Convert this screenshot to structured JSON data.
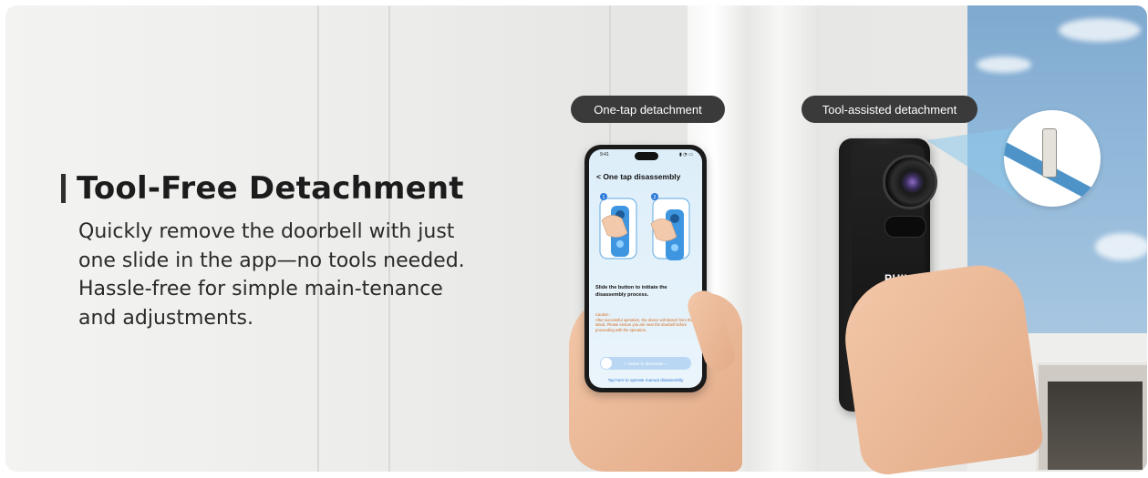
{
  "headline": "Tool-Free Detachment",
  "description": "Quickly remove the doorbell with just one slide in the app—no tools needed. Hassle-free for simple main-tenance and adjustments.",
  "labels": {
    "one_tap": "One-tap detachment",
    "tool_assisted": "Tool-assisted detachment"
  },
  "phone_screen": {
    "status_time": "9:41",
    "title": "< One tap disassembly",
    "step1": "1",
    "step2": "2",
    "instruction": "Slide the button to initiate the disassembly process.",
    "caution_label": "Caution :",
    "caution_text": "After successful operation, the device will detach from the stand. Please ensure you are near the doorbell before proceeding with the operation.",
    "swipe_label": "‹‹   Swipe to dismantle   ››",
    "manual_link": "Tap here to operate manual disassembly"
  },
  "doorbell": {
    "brand": "PHILIPS"
  },
  "colors": {
    "pill_bg": "#3a3a3a",
    "accent_bar": "#2f2f2f",
    "screen_bg": "#ddeef9",
    "link_blue": "#2f7bd8",
    "caution_orange": "#d66a1a"
  }
}
